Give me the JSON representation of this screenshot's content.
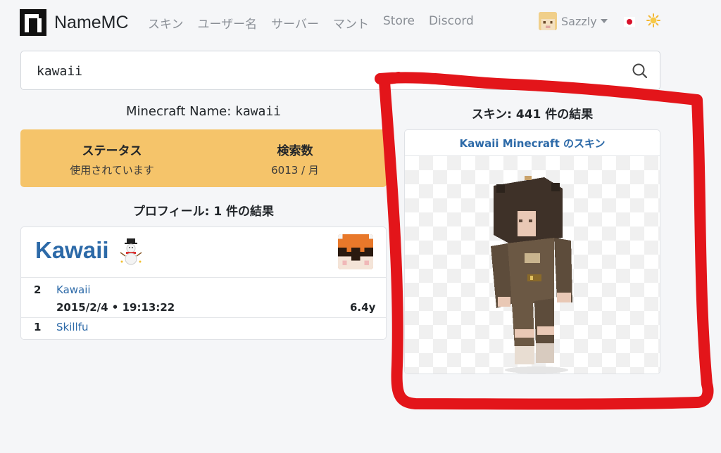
{
  "brand": {
    "name": "NameMC"
  },
  "nav": {
    "links": [
      {
        "label": "スキン"
      },
      {
        "label": "ユーザー名"
      },
      {
        "label": "サーバー"
      },
      {
        "label": "マント"
      },
      {
        "label": "Store"
      },
      {
        "label": "Discord"
      }
    ]
  },
  "user": {
    "name": "Sazzly"
  },
  "search": {
    "value": "kawaii"
  },
  "name_section": {
    "label": "Minecraft Name:",
    "name": "kawaii"
  },
  "status": {
    "title": "ステータス",
    "value": "使用されています",
    "searches_title": "検索数",
    "searches_value": "6013 / 月"
  },
  "profiles": {
    "heading": "プロフィール: 1 件の結果",
    "title": "Kawaii",
    "history": [
      {
        "num": "2",
        "name": "Kawaii",
        "date": "2015/2/4 • 19:13:22",
        "age": "6.4y"
      },
      {
        "num": "1",
        "name": "Skillfu"
      }
    ]
  },
  "skins": {
    "heading": "スキン: 441 件の結果",
    "card_title": "Kawaii Minecraft のスキン"
  },
  "colors": {
    "status_bg": "#f5c46a",
    "link": "#2d6aa8",
    "annotation": "#e3151a"
  }
}
